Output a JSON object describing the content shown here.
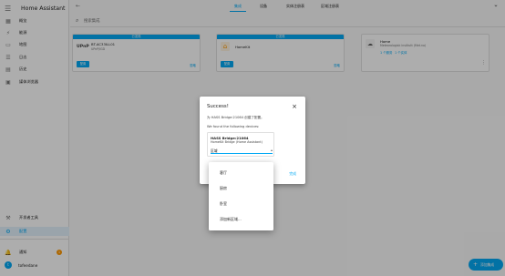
{
  "app": {
    "title": "Home Assistant"
  },
  "sidebar": {
    "items": [
      {
        "label": "概览",
        "icon": "view-dashboard-icon"
      },
      {
        "label": "能源",
        "icon": "lightning-icon"
      },
      {
        "label": "地图",
        "icon": "map-icon"
      },
      {
        "label": "日志",
        "icon": "list-icon"
      },
      {
        "label": "历史",
        "icon": "chart-icon"
      },
      {
        "label": "媒体浏览器",
        "icon": "media-icon"
      }
    ],
    "dev_tools": "开发者工具",
    "settings": "配置",
    "notifications": "通知",
    "notification_count": "1",
    "user": "tofeedane",
    "user_initial": "t"
  },
  "topbar": {
    "tabs": [
      "集成",
      "设备",
      "实体注册表",
      "区域注册表"
    ]
  },
  "search": {
    "placeholder": "搜索集成"
  },
  "cards": [
    {
      "header": "已发现",
      "logo_text": "UPnP",
      "name": "BT-AC33ILL01",
      "subtitle": "UPnP/IGD",
      "config": "配置",
      "ignore": "忽略"
    },
    {
      "header": "已发现",
      "name": "HomeKit",
      "config": "配置",
      "ignore": "忽略"
    },
    {
      "name": "Home",
      "subtitle": "Meteorologisk institutt (Met.no)",
      "link1": "1 个服务",
      "link2": "1 个实体"
    }
  ],
  "dialog": {
    "title": "Success!",
    "line1": "为 HASS Bridge:21064 创建了配置。",
    "line2": "We found the following devices:",
    "device_name": "HASS Bridge:21064",
    "device_model": "HomeKit Bridge (Home Assistant)",
    "area_value": "区域",
    "finish": "完成"
  },
  "area_menu": {
    "options": [
      "客厅",
      "厨房",
      "卧室",
      "添加新区域..."
    ]
  },
  "fab": {
    "label": "添加集成"
  },
  "colors": {
    "accent": "#03a9f4",
    "badge": "#ff9800"
  }
}
